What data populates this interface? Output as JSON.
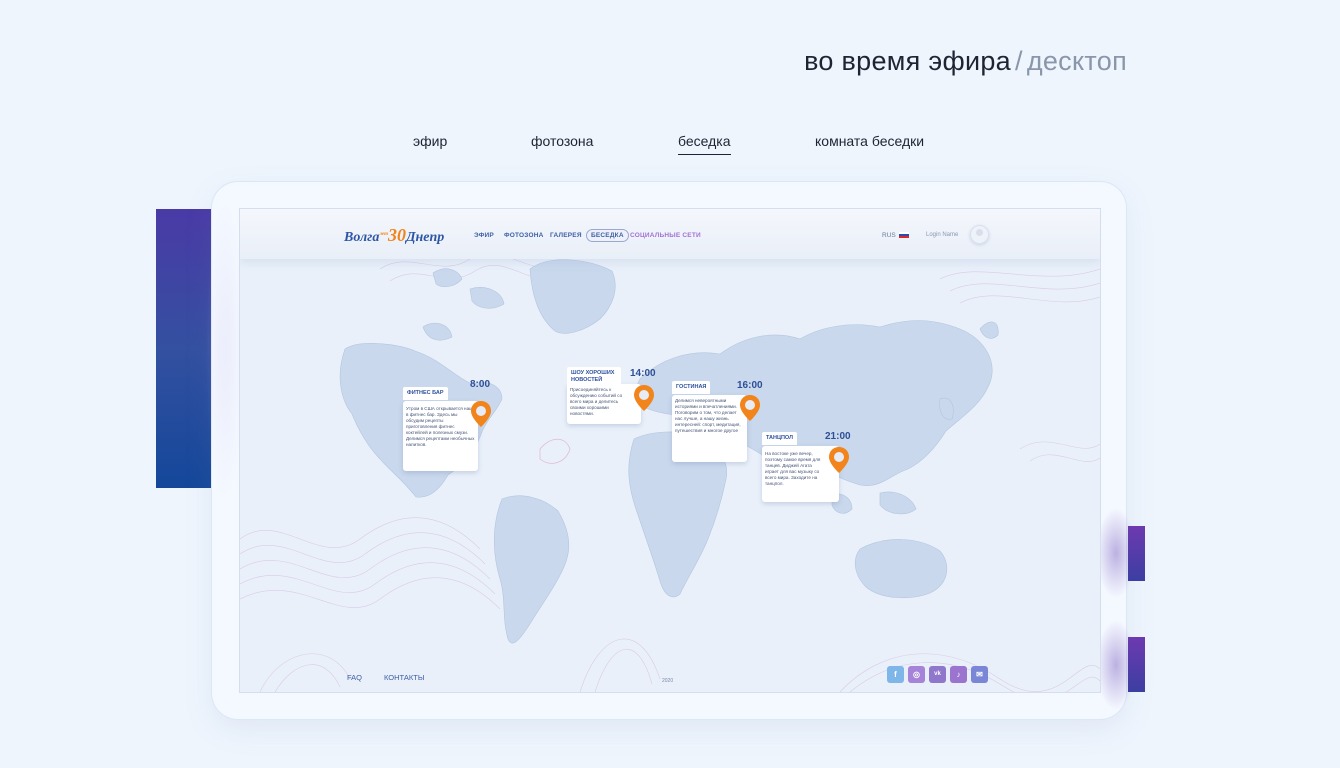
{
  "heading": {
    "main": "во время эфира",
    "separator": "/",
    "sub": "десктоп"
  },
  "tabs": [
    {
      "label": "эфир",
      "active": false
    },
    {
      "label": "фотозона",
      "active": false
    },
    {
      "label": "беседка",
      "active": true
    },
    {
      "label": "комната беседки",
      "active": false
    }
  ],
  "site": {
    "logo": {
      "left": "Волга",
      "number": "30",
      "small": "лет",
      "right": "Днепр"
    },
    "nav": [
      "ЭФИР",
      "ФОТОЗОНА",
      "ГАЛЕРЕЯ",
      "БЕСЕДКА",
      "СОЦИАЛЬНЫЕ СЕТИ"
    ],
    "language": "RUS",
    "login": "Login Name",
    "events": [
      {
        "tag": "ФИТНЕС БАР",
        "time": "8:00",
        "text": "Утром в США открывается наш в фитнес бар. Здесь мы обсудим рецепты приготовления фитнес коктейлей и полезных смузи. Делимся рецептами необычных напитков."
      },
      {
        "tag": "ШОУ ХОРОШИХ НОВОСТЕЙ",
        "time": "14:00",
        "text": "Присоединяйтесь к обсуждению событий со всего мира и делитесь своими хорошими новостями."
      },
      {
        "tag": "ГОСТИНАЯ",
        "time": "16:00",
        "text": "Делимся невероятными историями и впечатлениями. Поговорим о том, что делает нас лучше, а нашу жизнь интересней: спорт, медитация, путешествия и многое другое"
      },
      {
        "tag": "ТАНЦПОЛ",
        "time": "21:00",
        "text": "На востоке уже вечер, поэтому самое время для танцев. Диджей Агата играет для вас музыку со всего мира. Заходите на танцпол."
      }
    ],
    "footer": {
      "faq": "FAQ",
      "contacts": "КОНТАКТЫ",
      "year": "2020"
    },
    "socials": [
      {
        "icon": "facebook-icon",
        "glyph": "f",
        "color": "#7fb6ea"
      },
      {
        "icon": "instagram-icon",
        "glyph": "◎",
        "color": "#a583d8"
      },
      {
        "icon": "vk-icon",
        "glyph": "vk",
        "color": "#8f78cc"
      },
      {
        "icon": "tiktok-icon",
        "glyph": "♪",
        "color": "#9a74cf"
      },
      {
        "icon": "wechat-icon",
        "glyph": "✉",
        "color": "#7a86d6"
      }
    ],
    "colors": {
      "accent": "#f2841c",
      "brand": "#2d55a7"
    }
  }
}
